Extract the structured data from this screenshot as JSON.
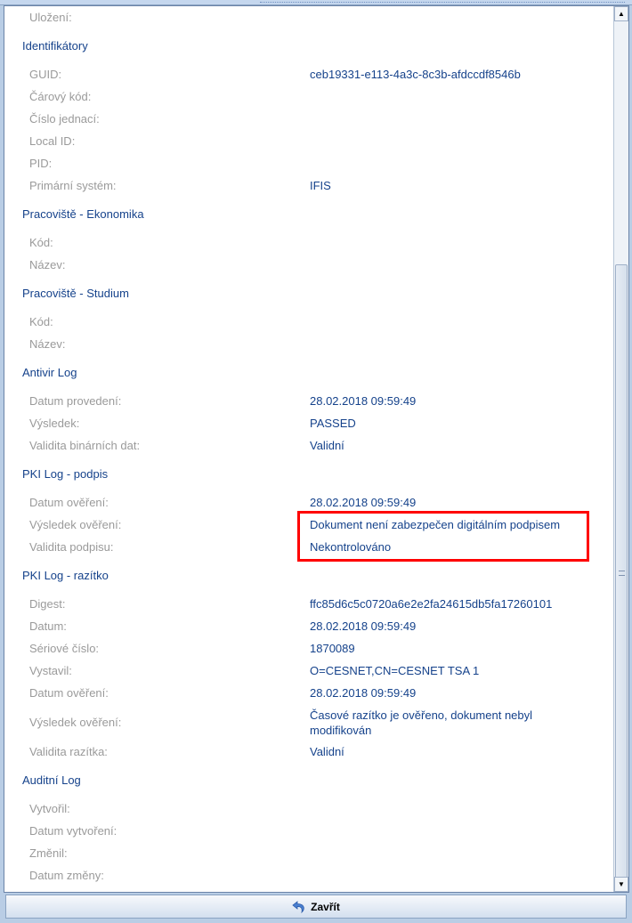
{
  "top": {
    "label": "Uložení:",
    "value": ""
  },
  "sections": [
    {
      "title": "Identifikátory",
      "rows": [
        {
          "label": "GUID:",
          "value": "ceb19331-e113-4a3c-8c3b-afdccdf8546b"
        },
        {
          "label": "Čárový kód:",
          "value": ""
        },
        {
          "label": "Číslo jednací:",
          "value": ""
        },
        {
          "label": "Local ID:",
          "value": ""
        },
        {
          "label": "PID:",
          "value": ""
        },
        {
          "label": "Primární systém:",
          "value": "IFIS"
        }
      ]
    },
    {
      "title": "Pracoviště - Ekonomika",
      "rows": [
        {
          "label": "Kód:",
          "value": ""
        },
        {
          "label": "Název:",
          "value": ""
        }
      ]
    },
    {
      "title": "Pracoviště - Studium",
      "rows": [
        {
          "label": "Kód:",
          "value": ""
        },
        {
          "label": "Název:",
          "value": ""
        }
      ]
    },
    {
      "title": "Antivir Log",
      "rows": [
        {
          "label": "Datum provedení:",
          "value": "28.02.2018 09:59:49"
        },
        {
          "label": "Výsledek:",
          "value": "PASSED"
        },
        {
          "label": "Validita binárních dat:",
          "value": "Validní"
        }
      ]
    },
    {
      "title": "PKI Log - podpis",
      "rows": [
        {
          "label": "Datum ověření:",
          "value": "28.02.2018 09:59:49"
        },
        {
          "label": "Výsledek ověření:",
          "value": "Dokument není zabezpečen digitálním podpisem"
        },
        {
          "label": "Validita podpisu:",
          "value": "Nekontrolováno"
        }
      ]
    },
    {
      "title": "PKI Log - razítko",
      "rows": [
        {
          "label": "Digest:",
          "value": "ffc85d6c5c0720a6e2e2fa24615db5fa17260101"
        },
        {
          "label": "Datum:",
          "value": "28.02.2018 09:59:49"
        },
        {
          "label": "Sériové číslo:",
          "value": "1870089"
        },
        {
          "label": "Vystavil:",
          "value": "O=CESNET,CN=CESNET TSA 1"
        },
        {
          "label": "Datum ověření:",
          "value": "28.02.2018 09:59:49"
        },
        {
          "label": "Výsledek ověření:",
          "value": "Časové razítko je ověřeno, dokument nebyl modifikován",
          "tall": true
        },
        {
          "label": "Validita razítka:",
          "value": "Validní"
        }
      ]
    },
    {
      "title": "Auditní Log",
      "rows": [
        {
          "label": "Vytvořil:",
          "value": ""
        },
        {
          "label": "Datum vytvoření:",
          "value": ""
        },
        {
          "label": "Změnil:",
          "value": ""
        },
        {
          "label": "Datum změny:",
          "value": ""
        }
      ]
    }
  ],
  "footer": {
    "close_label": "Zavřít",
    "icon": "undo-arrow-icon"
  },
  "colors": {
    "highlight": "#ff0000",
    "text": "#15428b",
    "label": "#9a9a9a"
  }
}
